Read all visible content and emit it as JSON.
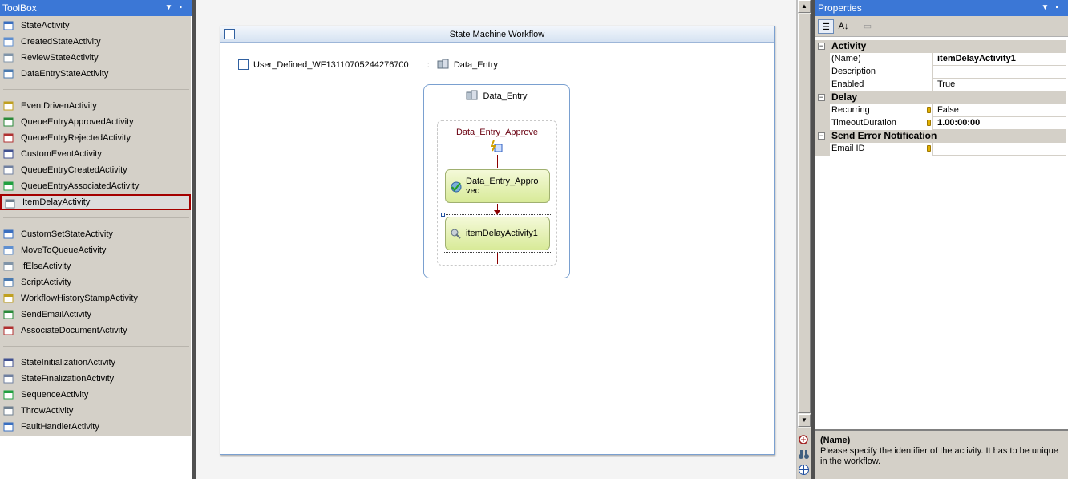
{
  "toolbox": {
    "title": "ToolBox",
    "groups": [
      [
        "StateActivity",
        "CreatedStateActivity",
        "ReviewStateActivity",
        "DataEntryStateActivity"
      ],
      [
        "EventDrivenActivity",
        "QueueEntryApprovedActivity",
        "QueueEntryRejectedActivity",
        "CustomEventActivity",
        "QueueEntryCreatedActivity",
        "QueueEntryAssociatedActivity",
        "ItemDelayActivity"
      ],
      [
        "CustomSetStateActivity",
        "MoveToQueueActivity",
        "IfElseActivity",
        "ScriptActivity",
        "WorkflowHistoryStampActivity",
        "SendEmailActivity",
        "AssociateDocumentActivity"
      ],
      [
        "StateInitializationActivity",
        "StateFinalizationActivity",
        "SequenceActivity",
        "ThrowActivity",
        "FaultHandlerActivity"
      ]
    ],
    "selected": "ItemDelayActivity"
  },
  "designer": {
    "frame_title": "State Machine Workflow",
    "workflow_name": "User_Defined_WF13110705244276700",
    "separator": ":",
    "initial_state": "Data_Entry",
    "state": {
      "name": "Data_Entry",
      "event_driven": {
        "name": "Data_Entry_Approve",
        "activities": [
          "Data_Entry_Approved",
          "itemDelayActivity1"
        ]
      }
    }
  },
  "properties": {
    "title": "Properties",
    "categories": [
      {
        "name": "Activity",
        "rows": [
          {
            "name": "(Name)",
            "value": "itemDelayActivity1",
            "bold": true,
            "locked": false
          },
          {
            "name": "Description",
            "value": "",
            "bold": false,
            "locked": false
          },
          {
            "name": "Enabled",
            "value": "True",
            "bold": false,
            "locked": false
          }
        ]
      },
      {
        "name": "Delay",
        "rows": [
          {
            "name": "Recurring",
            "value": "False",
            "bold": false,
            "locked": true
          },
          {
            "name": "TimeoutDuration",
            "value": "1.00:00:00",
            "bold": true,
            "locked": true
          }
        ]
      },
      {
        "name": "Send Error Notification",
        "rows": [
          {
            "name": "Email ID",
            "value": "",
            "bold": false,
            "locked": true
          }
        ]
      }
    ],
    "description": {
      "title": "(Name)",
      "text": "Please specify the identifier of the activity. It has to be unique in the workflow."
    }
  }
}
